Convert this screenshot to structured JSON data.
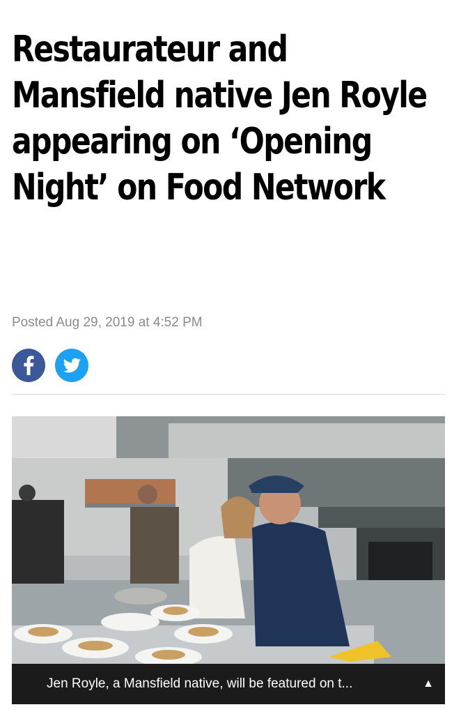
{
  "article": {
    "headline": "Restaurateur and Mansfield native Jen Royle appearing on ‘Opening Night’ on Food Network",
    "byline": "Posted Aug 29, 2019 at 4:52 PM"
  },
  "share": {
    "facebook_icon": "facebook-icon",
    "twitter_icon": "twitter-icon",
    "facebook_color": "#3b5998",
    "twitter_color": "#1da1f2"
  },
  "photo": {
    "caption": "Jen Royle, a Mansfield native, will be featured on t...",
    "toggle_glyph": "▲"
  }
}
